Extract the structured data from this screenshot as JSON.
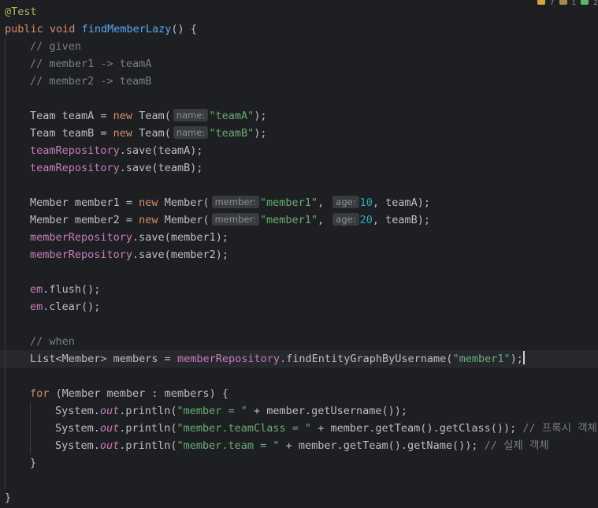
{
  "editor": {
    "colors": {
      "background": "#1e1f22",
      "keyword": "#cf8e6d",
      "method": "#56a8f5",
      "string": "#6aab73",
      "number": "#2aacb8",
      "comment": "#7a7e85",
      "field": "#c77dbb",
      "annotation": "#b3ae60"
    },
    "inspection_counts": {
      "warnings": "7",
      "weak_warnings": "1",
      "typos": "2"
    },
    "code": {
      "annotation": "@Test",
      "kw_public": "public",
      "kw_void": "void",
      "method_name": "findMemberLazy",
      "sig_tail": "() {",
      "cmt_given": "// given",
      "cmt_member1": "// member1 -> teamA",
      "cmt_member2": "// member2 -> teamB",
      "team_a_decl": "Team teamA = ",
      "team_b_decl": "Team teamB = ",
      "kw_new": "new",
      "team_ctor": " Team(",
      "hint_name": "name:",
      "str_team_a": "\"teamA\"",
      "str_team_b": "\"teamB\"",
      "close_stmt": ");",
      "team_repo": "teamRepository",
      "save_team_a": ".save(teamA);",
      "save_team_b": ".save(teamB);",
      "member1_decl": "Member member1 = ",
      "member2_decl": "Member member2 = ",
      "member_ctor": " Member(",
      "hint_member": "member:",
      "str_member1": "\"member1\"",
      "comma": ",",
      "hint_age": "age:",
      "num_10": "10",
      "num_20": "20",
      "tail_team_a": ", teamA);",
      "tail_team_b": ", teamB);",
      "member_repo": "memberRepository",
      "save_member1": ".save(member1);",
      "save_member2": ".save(member2);",
      "em": "em",
      "flush": ".flush();",
      "clear": ".clear();",
      "cmt_when": "// when",
      "list_decl": "List<Member> members = ",
      "find_call": ".findEntityGraphByUsername(",
      "kw_for": "for",
      "for_head": " (Member member : members) {",
      "system": "System.",
      "out": "out",
      "println_open": ".println(",
      "str_member_eq": "\"member = \"",
      "p1_tail": " + member.getUsername());",
      "str_team_class": "\"member.teamClass = \"",
      "p2_tail": " + member.getTeam().getClass()); ",
      "cmt_proxy": "// 프록시 객체",
      "str_member_team": "\"member.team = \"",
      "p3_tail": " + member.getTeam().getName()); ",
      "cmt_real": "// 실제 객체",
      "brace_close": "}"
    }
  }
}
